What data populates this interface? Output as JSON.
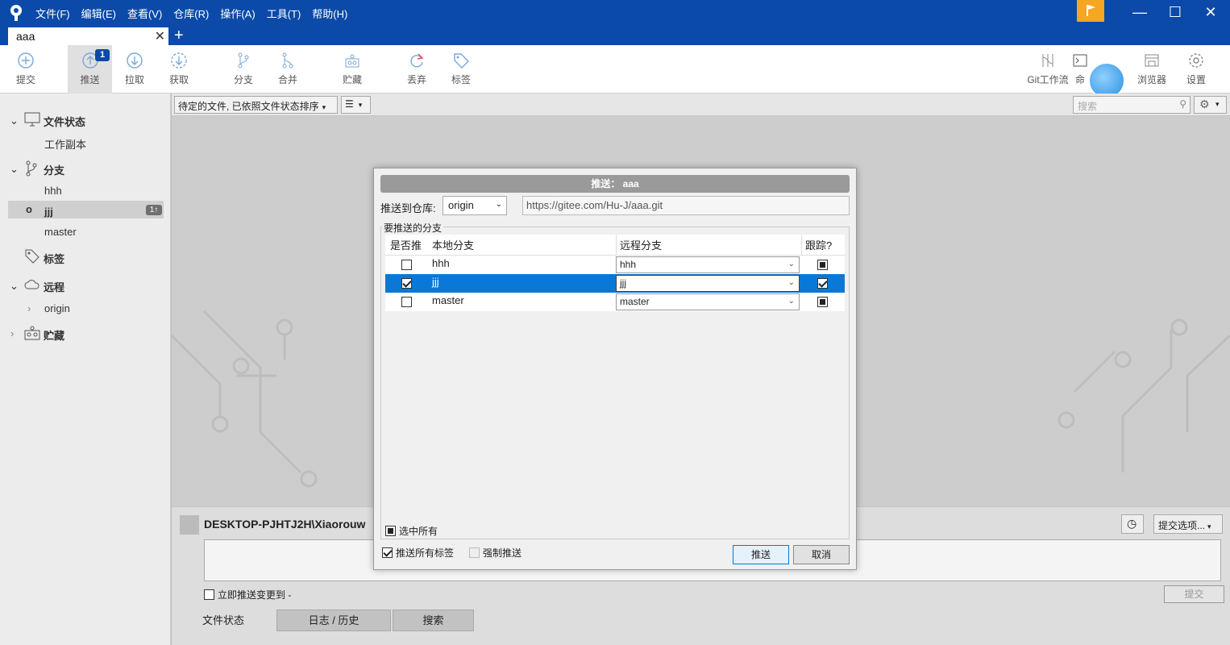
{
  "menu": [
    "文件(F)",
    "编辑(E)",
    "查看(V)",
    "仓库(R)",
    "操作(A)",
    "工具(T)",
    "帮助(H)"
  ],
  "window_controls": {
    "minimize": "—",
    "maximize": "☐",
    "close": "✕"
  },
  "tab": {
    "label": "aaa",
    "close": "✕",
    "new": "+"
  },
  "toolbar": {
    "commit": "提交",
    "push": "推送",
    "push_badge": "1",
    "pull": "拉取",
    "fetch": "获取",
    "branch": "分支",
    "merge": "合并",
    "stash": "贮藏",
    "discard": "丢弃",
    "tag": "标签",
    "git_flow": "Git工作流",
    "terminal": "命",
    "browser": "浏览器",
    "settings": "设置"
  },
  "sidebar": {
    "file_status": "文件状态",
    "working_copy": "工作副本",
    "branches": "分支",
    "branch_items": [
      "hhh",
      "jjj",
      "master"
    ],
    "jjj_badge": "1↑",
    "tags": "标签",
    "remotes": "远程",
    "remote_items": [
      "origin"
    ],
    "stashes": "贮藏"
  },
  "filter": {
    "sort_label": "待定的文件, 已依照文件状态排序",
    "search_placeholder": "搜索"
  },
  "commit_area": {
    "user": "DESKTOP-PJHTJ2H\\Xiaorouw",
    "push_immediately": "立即推送变更到 -",
    "options": "提交选项...",
    "commit_button": "提交"
  },
  "bottom_tabs": [
    "文件状态",
    "日志 / 历史",
    "搜索"
  ],
  "dialog": {
    "title": "推送： aaa",
    "remote_label": "推送到仓库:",
    "remote_value": "origin",
    "remote_url": "https://gitee.com/Hu-J/aaa.git",
    "group_label": "要推送的分支",
    "columns": {
      "push": "是否推",
      "local": "本地分支",
      "remote": "远程分支",
      "track": "跟踪?"
    },
    "rows": [
      {
        "push": false,
        "local": "hhh",
        "remote": "hhh",
        "track": "filled",
        "selected": false
      },
      {
        "push": true,
        "local": "jjj",
        "remote": "jjj",
        "track": "checked",
        "selected": true
      },
      {
        "push": false,
        "local": "master",
        "remote": "master",
        "track": "filled",
        "selected": false
      }
    ],
    "select_all": "选中所有",
    "push_all_tags": "推送所有标签",
    "force_push": "强制推送",
    "ok": "推送",
    "cancel": "取消"
  },
  "colors": {
    "titlebar": "#0b4aa8",
    "selection": "#0a78d7",
    "flag": "#f5a623"
  }
}
